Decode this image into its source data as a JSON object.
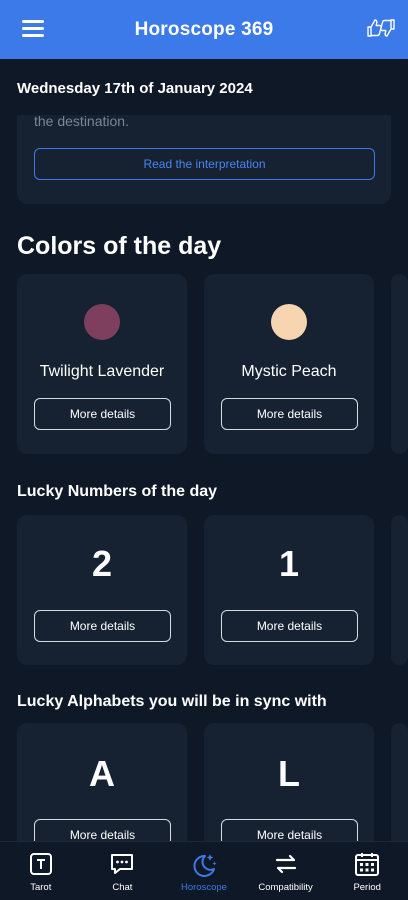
{
  "app": {
    "title": "Horoscope 369"
  },
  "date": "Wednesday 17th of January 2024",
  "interpretation": {
    "tail_text": "the destination.",
    "button": "Read the interpretation"
  },
  "colors": {
    "heading": "Colors of the day",
    "items": [
      {
        "name": "Twilight Lavender",
        "hex": "#7e3e5e",
        "button": "More details"
      },
      {
        "name": "Mystic Peach",
        "hex": "#f7d5b0",
        "button": "More details"
      }
    ]
  },
  "numbers": {
    "heading": "Lucky Numbers of the day",
    "items": [
      {
        "value": "2",
        "button": "More details"
      },
      {
        "value": "1",
        "button": "More details"
      }
    ]
  },
  "alphabets": {
    "heading": "Lucky Alphabets you will be in sync with",
    "items": [
      {
        "value": "A",
        "button": "More details"
      },
      {
        "value": "L",
        "button": "More details"
      }
    ]
  },
  "nav": [
    {
      "label": "Tarot",
      "icon": "tarot-card-icon",
      "active": false
    },
    {
      "label": "Chat",
      "icon": "chat-bubble-icon",
      "active": false
    },
    {
      "label": "Horoscope",
      "icon": "moon-stars-icon",
      "active": true
    },
    {
      "label": "Compatibility",
      "icon": "swap-arrows-icon",
      "active": false
    },
    {
      "label": "Period",
      "icon": "calendar-icon",
      "active": false
    }
  ],
  "theme": {
    "accent": "#3b7ae8",
    "background": "#0f1826",
    "card": "#162131"
  }
}
